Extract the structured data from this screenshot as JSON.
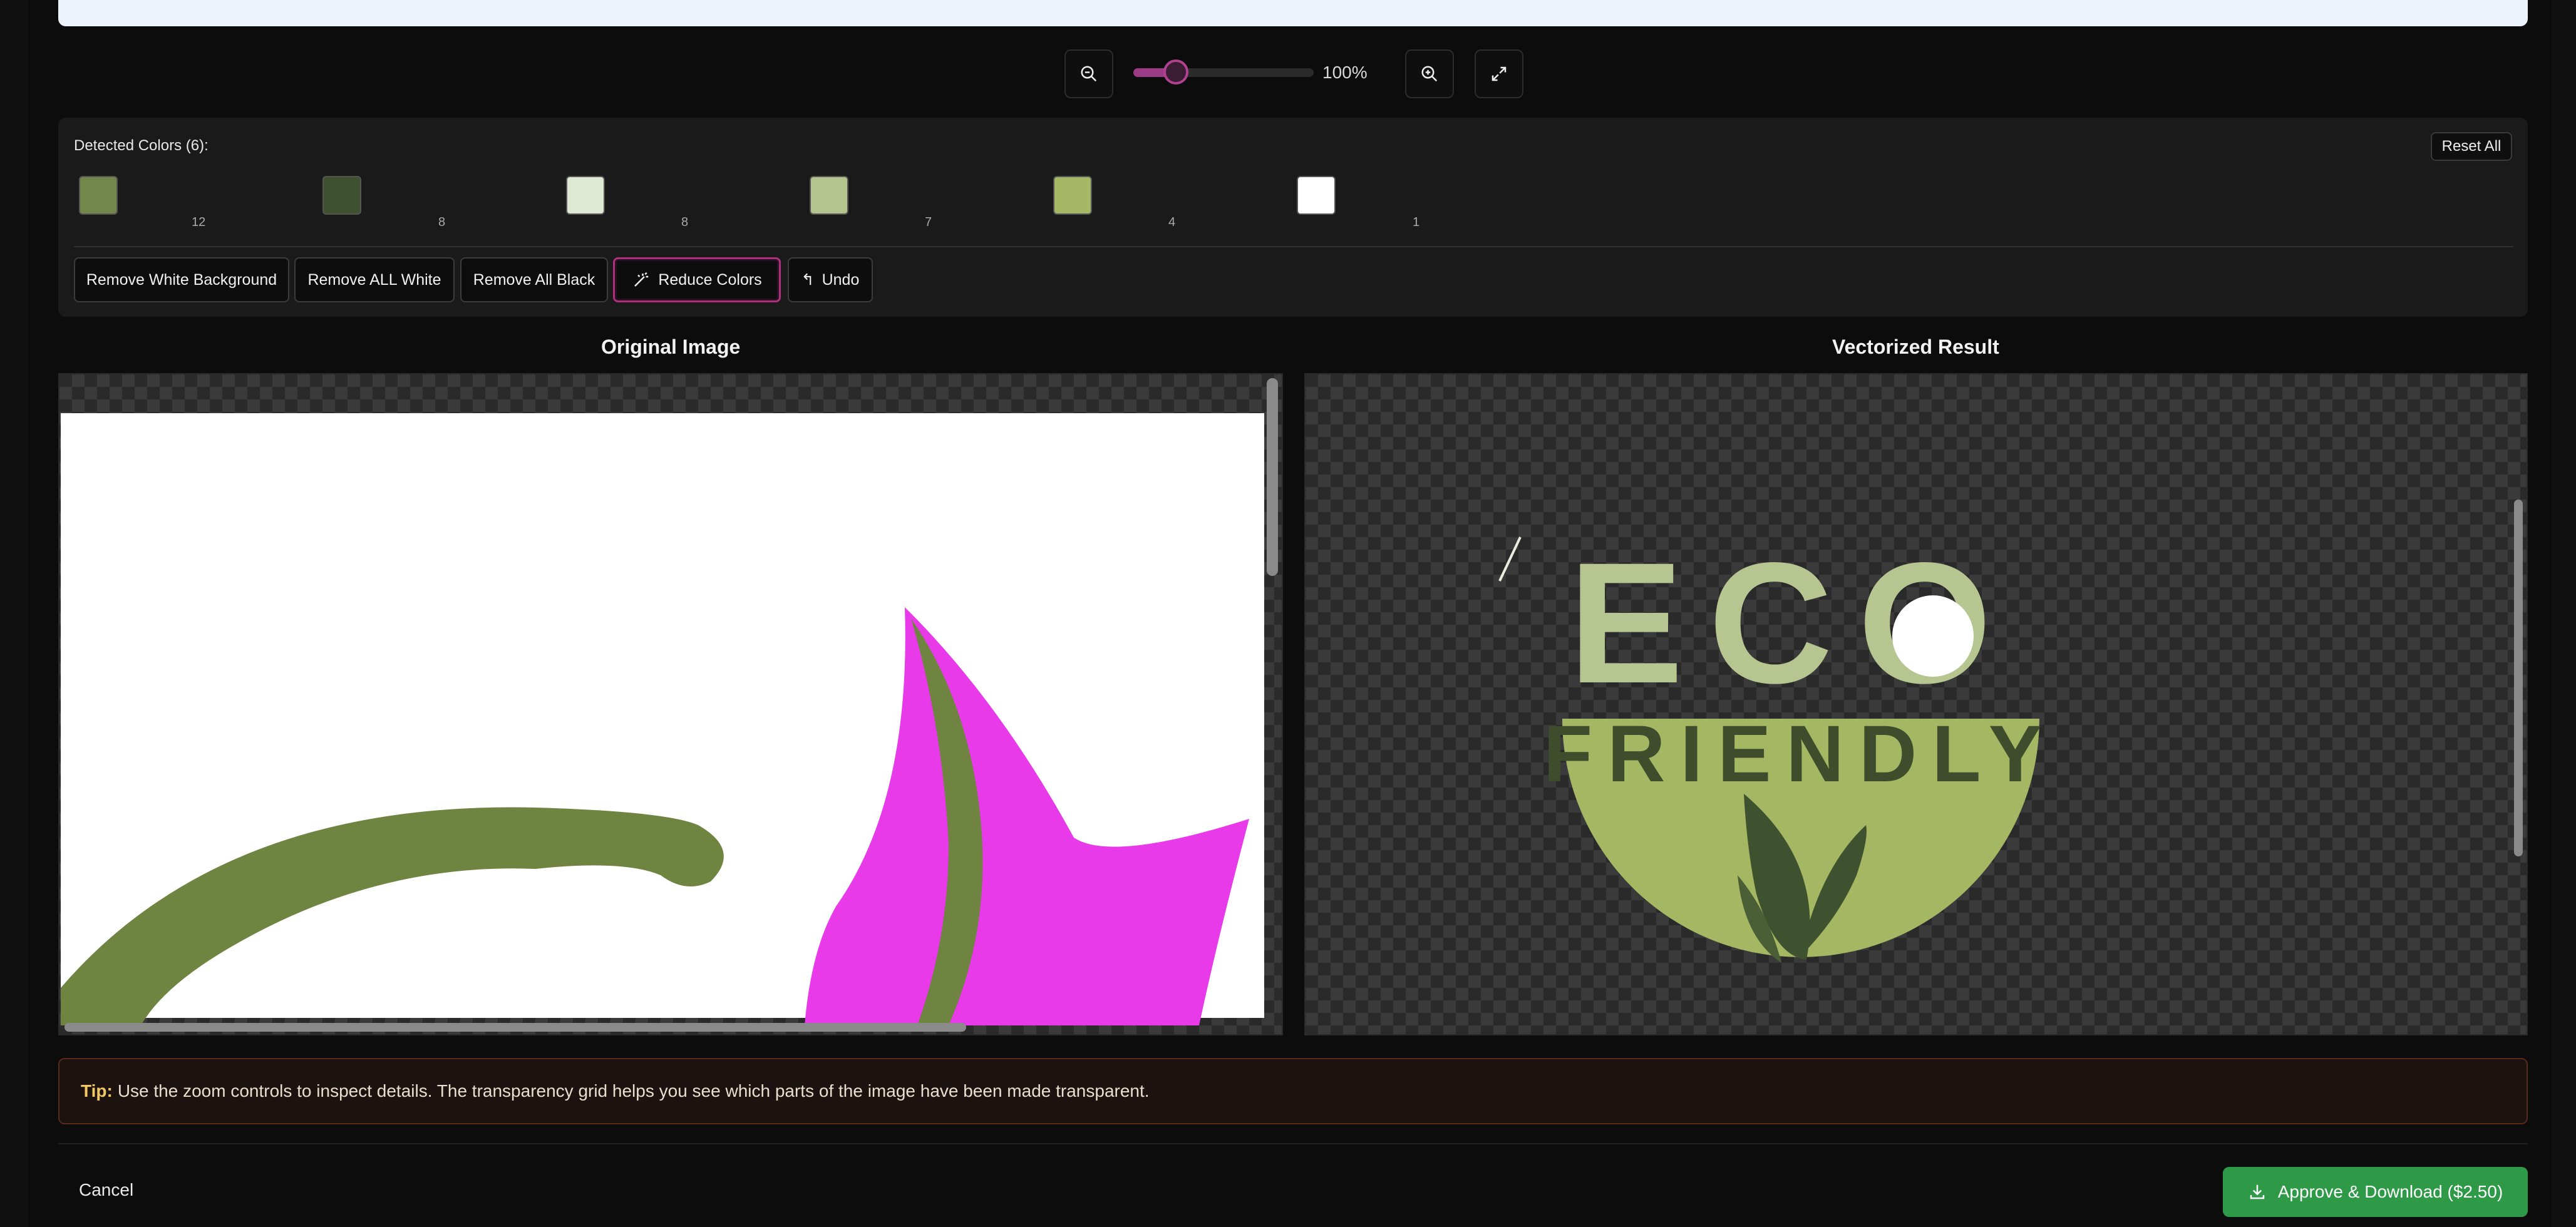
{
  "zoom": {
    "percent_label": "100%",
    "level": 100
  },
  "colors_panel": {
    "title": "Detected Colors (6):",
    "reset_label": "Reset All",
    "swatches": [
      {
        "color": "#74874a",
        "count": "12"
      },
      {
        "color": "#3f5230",
        "count": "8"
      },
      {
        "color": "#dfe8d2",
        "count": "8"
      },
      {
        "color": "#b5c48e",
        "count": "7"
      },
      {
        "color": "#a6b865",
        "count": "4"
      },
      {
        "color": "#ffffff",
        "count": "1"
      }
    ],
    "actions": {
      "remove_white_bg": "Remove White Background",
      "remove_all_white": "Remove ALL White",
      "remove_all_black": "Remove All Black",
      "reduce_colors": "Reduce Colors",
      "undo": "Undo"
    }
  },
  "original": {
    "title": "Original Image"
  },
  "vectorized": {
    "title": "Vectorized Result",
    "logo_word": "ECO",
    "logo_sub": "FRIENDLY"
  },
  "tip": {
    "label": "Tip:",
    "text": "Use the zoom controls to inspect details. The transparency grid helps you see which parts of the image have been made transparent."
  },
  "footer": {
    "cancel_label": "Cancel",
    "approve_label": "Approve & Download ($2.50)"
  },
  "colors": {
    "accent": "#b1418f",
    "approve": "#2e9a48"
  }
}
